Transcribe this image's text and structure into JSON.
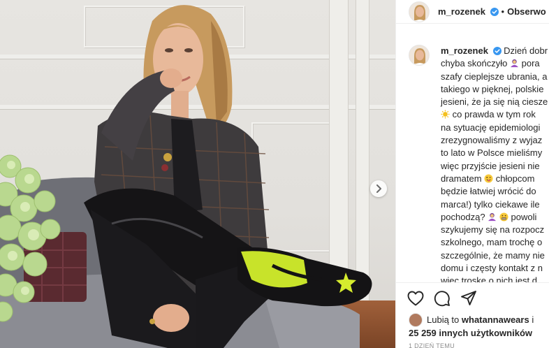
{
  "header": {
    "username": "m_rozenek",
    "separator": "•",
    "follow_label": "Obserwo"
  },
  "caption": {
    "username": "m_rozenek",
    "lines": [
      "Dzień dobr",
      "chyba skończyło",
      "pora",
      "szafy cieplejsze ubrania, a",
      "takiego w pięknej, polskie",
      "jesieni, że ja się nią ciesze",
      "co prawda w tym rok",
      "na sytuację epidemiologi",
      "zrezygnowaliśmy z wyjaz",
      "to lato w Polsce mieliśmy",
      "więc przyjście jesieni nie",
      "dramatem",
      "chłopcom",
      "będzie łatwiej wrócić do",
      "marca!) tylko ciekawe ile",
      "pochodzą?",
      "powoli",
      "szykujemy się na rozpocz",
      "szkolnego, mam trochę o",
      "szczególnie, że mamy nie",
      "domu i częsty kontakt z n",
      "więc troskę o nich jest d"
    ]
  },
  "likes": {
    "prefix": "Lubią to",
    "liker": "whatannawears",
    "conj": "i",
    "others": "25 259 innych użytkowników"
  },
  "timestamp": "1 DZIEŃ TEMU",
  "icons": {
    "like": "heart-icon",
    "comment": "comment-icon",
    "share": "share-icon",
    "next": "chevron-right-icon",
    "verified": "verified-badge-icon"
  },
  "colors": {
    "verified_blue": "#3897f0",
    "text": "#262626",
    "muted": "#8e8e8e",
    "divider": "#efefef",
    "boot_accent": "#c8e32a"
  }
}
